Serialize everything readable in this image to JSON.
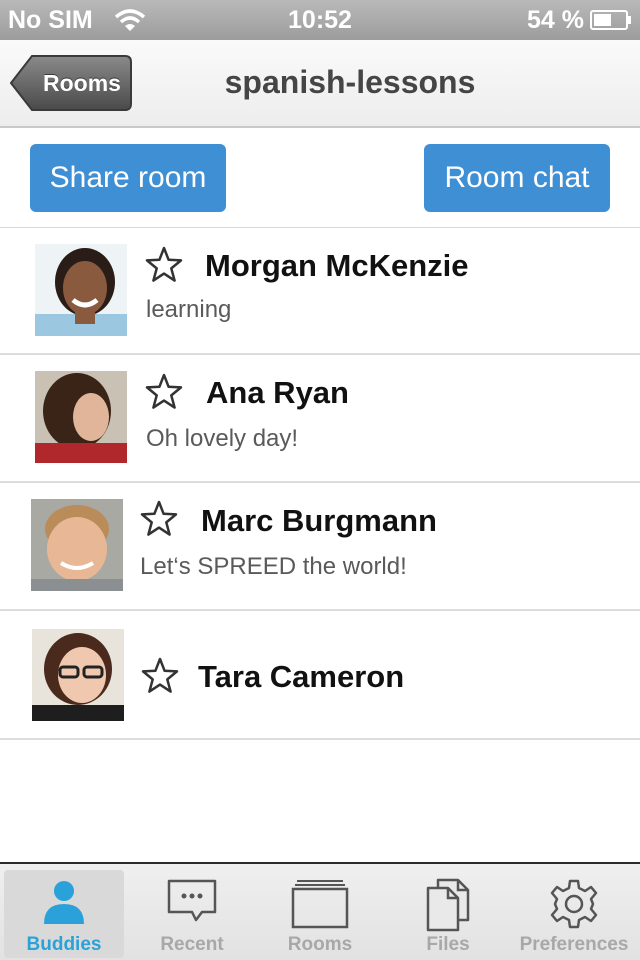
{
  "status_bar": {
    "carrier": "No SIM",
    "time": "10:52",
    "battery": "54 %"
  },
  "nav": {
    "back_label": "Rooms",
    "title": "spanish-lessons"
  },
  "actions": {
    "share_label": "Share room",
    "chat_label": "Room chat"
  },
  "buddies": [
    {
      "name": "Morgan McKenzie",
      "status": "learning"
    },
    {
      "name": "Ana Ryan",
      "status": "Oh lovely day!"
    },
    {
      "name": "Marc Burgmann",
      "status": "Let‘s SPREED the world!"
    },
    {
      "name": "Tara Cameron",
      "status": ""
    }
  ],
  "tabs": [
    {
      "label": "Buddies",
      "icon": "person-icon"
    },
    {
      "label": "Recent",
      "icon": "chat-bubble-icon"
    },
    {
      "label": "Rooms",
      "icon": "rooms-stack-icon"
    },
    {
      "label": "Files",
      "icon": "documents-icon"
    },
    {
      "label": "Preferences",
      "icon": "gear-icon"
    }
  ],
  "colors": {
    "accent_button": "#3f8fd5",
    "tab_active": "#2aa2d9",
    "tab_inactive": "#a8a8a8"
  }
}
